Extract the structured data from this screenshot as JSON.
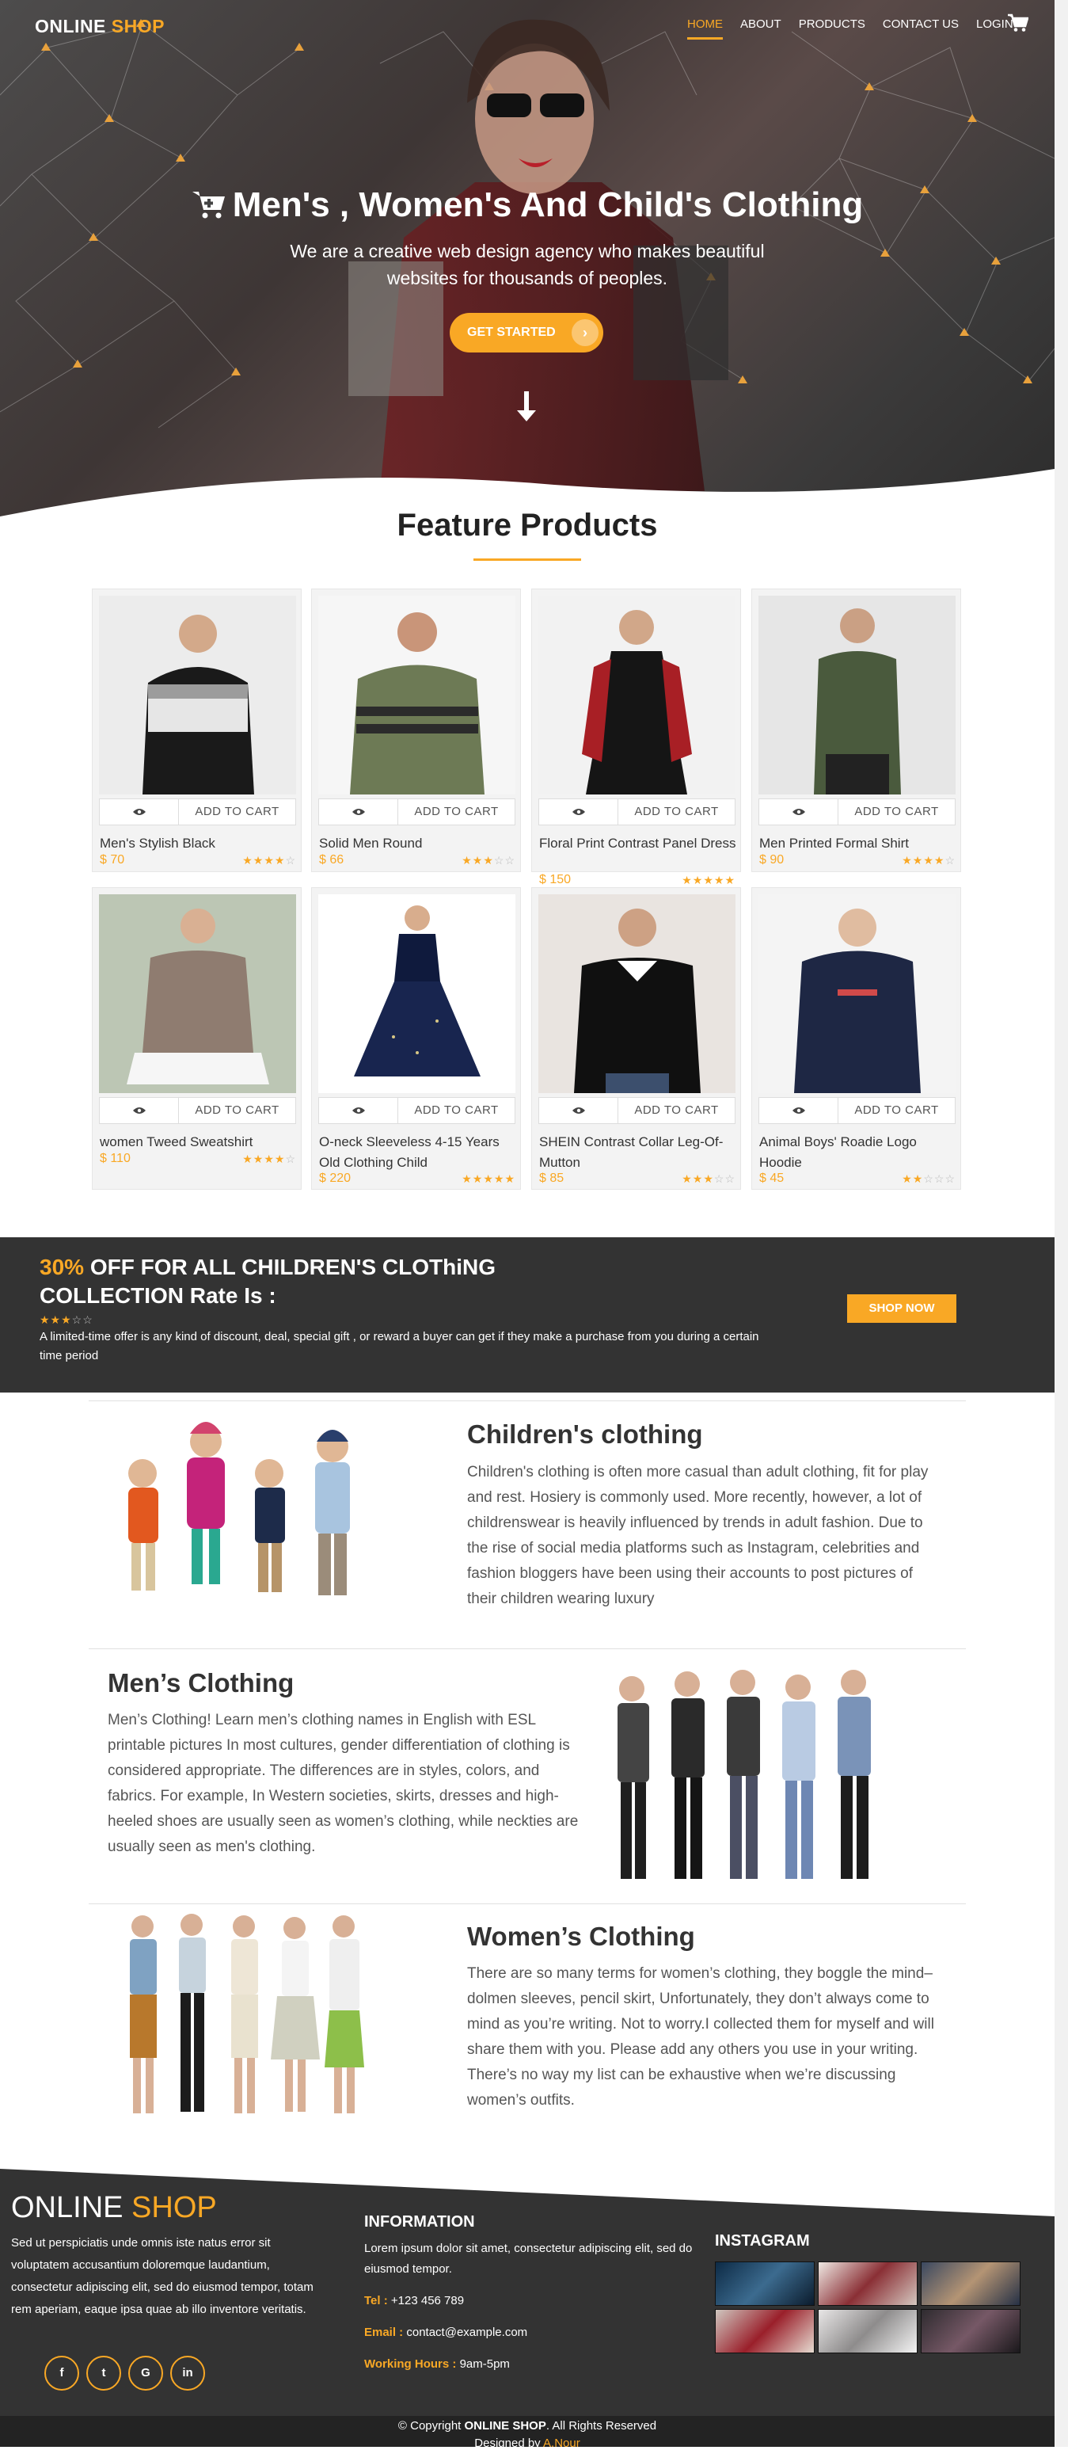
{
  "nav": {
    "logo_main": "ONLINE",
    "logo_accent": "SHOP",
    "items": [
      {
        "label": "HOME",
        "active": true
      },
      {
        "label": "ABOUT",
        "active": false
      },
      {
        "label": "PRODUCTS",
        "active": false
      },
      {
        "label": "CONTACT US",
        "active": false
      },
      {
        "label": "LOGIN",
        "active": false
      }
    ],
    "cart_icon": "shopping-cart-icon"
  },
  "hero": {
    "title": "Men's , Women's And Child's Clothing",
    "subtitle": "We are a creative web design agency who makes beautiful websites for thousands of peoples.",
    "button_label": "GET STARTED",
    "button_icon": "chevron-right-icon",
    "scroll_icon": "arrow-down-icon"
  },
  "featured": {
    "title": "Feature Products",
    "action_label": "ADD TO CART",
    "view_icon": "eye-icon",
    "products": [
      {
        "name": "Men's Stylish Black",
        "price": "$ 70",
        "rating": 4
      },
      {
        "name": "Solid Men Round",
        "price": "$ 66",
        "rating": 3
      },
      {
        "name": "Floral Print Contrast Panel Dress",
        "price": "$ 150",
        "rating": 5
      },
      {
        "name": "Men Printed Formal Shirt",
        "price": "$ 90",
        "rating": 4
      },
      {
        "name": "women Tweed Sweatshirt",
        "price": "$ 110",
        "rating": 4
      },
      {
        "name": "O-neck Sleeveless 4-15 Years Old Clothing Child",
        "price": "$ 220",
        "rating": 5
      },
      {
        "name": "SHEIN Contrast Collar Leg-Of-Mutton",
        "price": "$ 85",
        "rating": 3
      },
      {
        "name": "Animal Boys' Roadie Logo Hoodie",
        "price": "$ 45",
        "rating": 2
      }
    ]
  },
  "promo": {
    "percent": "30%",
    "headline": "OFF FOR ALL CHILDREN'S CLOThiNG COLLECTION Rate Is :",
    "rating": 3,
    "text": "A limited-time offer is any kind of discount, deal, special gift , or reward a buyer can get if they make a purchase from you during a certain time period",
    "button_label": "SHOP NOW"
  },
  "sections": [
    {
      "title": "Children's clothing",
      "text": "Children's clothing is often more casual than adult clothing, fit for play and rest. Hosiery is commonly used. More recently, however, a lot of childrenswear is heavily influenced by trends in adult fashion. Due to the rise of social media platforms such as Instagram, celebrities and fashion bloggers have been using their accounts to post pictures of their children wearing luxury"
    },
    {
      "title": "Men’s Clothing",
      "text": "Men’s Clothing! Learn men’s clothing names in English with ESL printable pictures In most cultures, gender differentiation of clothing is considered appropriate. The differences are in styles, colors, and fabrics. For example, In Western societies, skirts, dresses and high-heeled shoes are usually seen as women’s clothing, while neckties are usually seen as men's clothing."
    },
    {
      "title": "Women’s Clothing",
      "text": "There are so many terms for women’s clothing, they boggle the mind–dolmen sleeves, pencil skirt, Unfortunately, they don’t always come to mind as you’re writing. Not to worry.I collected them for myself and will share them with you. Please add any others you use in your writing. There’s no way my list can be exhaustive when we’re discussing women’s outfits."
    }
  ],
  "footer": {
    "logo_main": "ONLINE",
    "logo_accent": "SHOP",
    "description": "Sed ut perspiciatis unde omnis iste natus error sit voluptatem accusantium doloremque laudantium, consectetur adipiscing elit, sed do eiusmod tempor, totam rem aperiam, eaque ipsa quae ab illo inventore veritatis.",
    "social": [
      {
        "icon": "facebook-icon",
        "glyph": "f"
      },
      {
        "icon": "twitter-icon",
        "glyph": "t"
      },
      {
        "icon": "google-icon",
        "glyph": "G"
      },
      {
        "icon": "linkedin-icon",
        "glyph": "in"
      }
    ],
    "info_title": "INFORMATION",
    "info_text": "Lorem ipsum dolor sit amet, consectetur adipiscing elit, sed do eiusmod tempor.",
    "tel_label": "Tel :",
    "tel_value": "+123 456 789",
    "email_label": "Email :",
    "email_value": "contact@example.com",
    "hours_label": "Working Hours :",
    "hours_value": "9am-5pm",
    "instagram_title": "INSTAGRAM",
    "copyright_prefix": "© Copyright",
    "copyright_brand": "ONLINE SHOP",
    "copyright_suffix": ". All Rights Reserved",
    "designed_prefix": "Designed by",
    "designed_by": "A.Nour"
  },
  "colors": {
    "accent": "#f9a825",
    "dark": "#333333",
    "footer_bottom": "#232323"
  }
}
